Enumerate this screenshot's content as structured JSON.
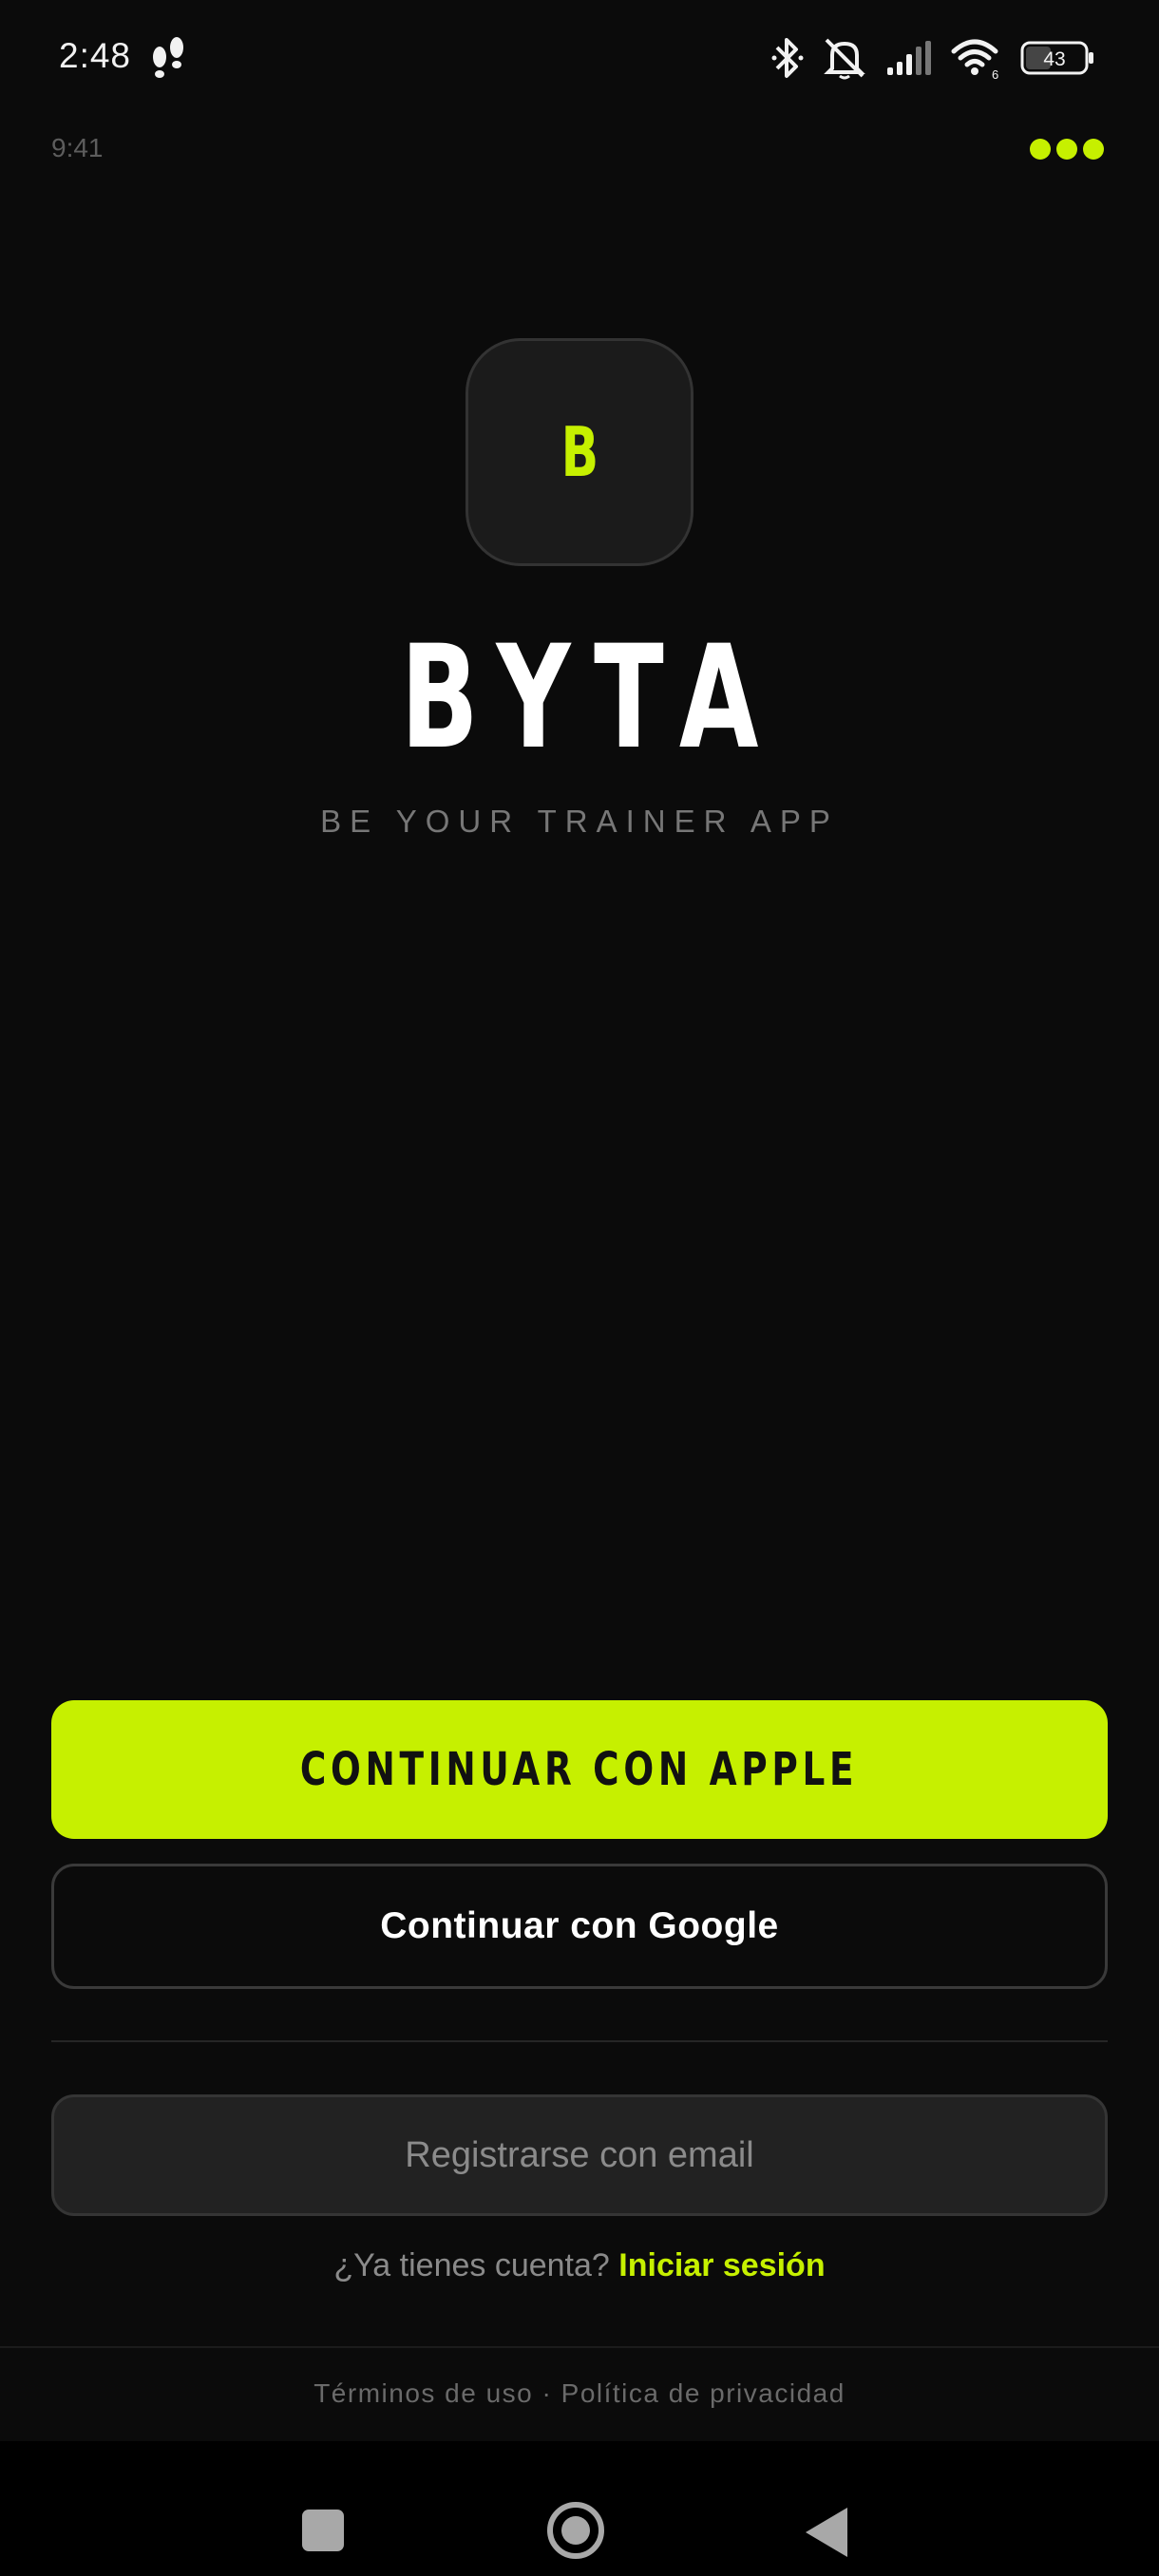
{
  "status_bar": {
    "time": "2:48",
    "battery_level": "43",
    "wifi_badge": "6",
    "icons": [
      "steps-icon",
      "bluetooth-icon",
      "mute-icon",
      "signal-icon",
      "wifi-icon",
      "battery-icon"
    ]
  },
  "app_header": {
    "time": "9:41",
    "menu_icon": "more-dots-icon"
  },
  "brand": {
    "logo_letter": "B",
    "title": "BYTA",
    "tagline": "BE YOUR TRAINER APP"
  },
  "auth": {
    "apple_button": "CONTINUAR CON APPLE",
    "google_button": "Continuar con Google",
    "email_button": "Registrarse con email",
    "login_prompt": "¿Ya tienes cuenta?",
    "login_link": "Iniciar sesión"
  },
  "footer": {
    "terms": "Términos de uso",
    "separator": " · ",
    "privacy": "Política de privacidad"
  },
  "colors": {
    "accent": "#c6f000",
    "background": "#0b0b0b",
    "surface": "#1b1b1b"
  },
  "nav_bar": {
    "icons": [
      "recents-icon",
      "home-icon",
      "back-icon"
    ]
  }
}
